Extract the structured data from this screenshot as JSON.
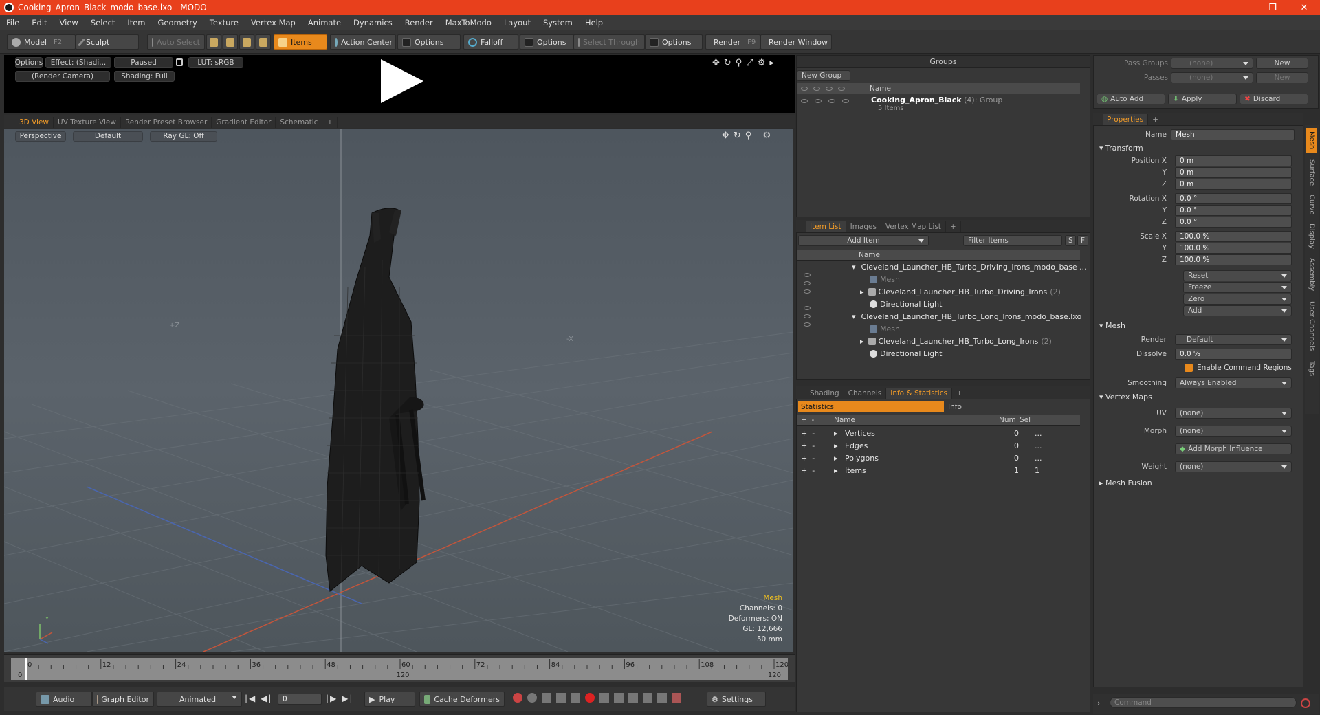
{
  "window": {
    "title": "Cooking_Apron_Black_modo_base.lxo - MODO",
    "min": "–",
    "max": "❐",
    "close": "✕"
  },
  "menu": [
    "File",
    "Edit",
    "View",
    "Select",
    "Item",
    "Geometry",
    "Texture",
    "Vertex Map",
    "Animate",
    "Dynamics",
    "Render",
    "MaxToModo",
    "Layout",
    "System",
    "Help"
  ],
  "toolbar": {
    "model": "Model",
    "model_key": "F2",
    "sculpt": "Sculpt",
    "auto_select": "Auto Select",
    "items": "Items",
    "action_center": "Action Center",
    "options1": "Options",
    "falloff": "Falloff",
    "options2": "Options",
    "select_through": "Select Through",
    "options3": "Options",
    "render": "Render",
    "render_key": "F9",
    "render_window": "Render Window"
  },
  "preview": {
    "options": "Options",
    "effect": "Effect: (Shadi...",
    "paused": "Paused",
    "lut": "LUT: sRGB",
    "camera": "(Render Camera)",
    "shading": "Shading: Full"
  },
  "viewport_tabs": [
    "3D View",
    "UV Texture View",
    "Render Preset Browser",
    "Gradient Editor",
    "Schematic",
    "+"
  ],
  "viewport": {
    "perspective": "Perspective",
    "default": "Default",
    "raygl": "Ray GL: Off",
    "info_title": "Mesh",
    "channels": "Channels: 0",
    "deformers": "Deformers: ON",
    "gl": "GL: 12,666",
    "lens": "50 mm",
    "axis_z": "+Z",
    "axis_x": "-X",
    "gizmo_y": "Y"
  },
  "timeline": {
    "ticks": [
      "0",
      "12",
      "24",
      "36",
      "48",
      "60",
      "72",
      "84",
      "96",
      "108",
      "120"
    ],
    "start": "0",
    "mid": "120",
    "end": "120"
  },
  "bottom": {
    "audio": "Audio",
    "graph_editor": "Graph Editor",
    "animated": "Animated",
    "frame": "0",
    "play": "Play",
    "cache": "Cache Deformers",
    "settings": "Settings"
  },
  "groups": {
    "title": "Groups",
    "new_group": "New Group",
    "col_name": "Name",
    "group_name": "Cooking_Apron_Black",
    "group_count": "(4)",
    "group_type": ": Group",
    "group_items": "5 Items"
  },
  "itemlist": {
    "tabs": [
      "Item List",
      "Images",
      "Vertex Map List",
      "+"
    ],
    "add_item": "Add Item",
    "filter": "Filter Items",
    "s": "S",
    "f": "F",
    "col_name": "Name",
    "rows": [
      {
        "name": "Cleveland_Launcher_HB_Turbo_Driving_Irons_modo_base ...",
        "suffix": ""
      },
      {
        "name": "Mesh",
        "suffix": ""
      },
      {
        "name": "Cleveland_Launcher_HB_Turbo_Driving_Irons",
        "suffix": "(2)"
      },
      {
        "name": "Directional Light",
        "suffix": ""
      },
      {
        "name": "Cleveland_Launcher_HB_Turbo_Long_Irons_modo_base.lxo",
        "suffix": ""
      },
      {
        "name": "Mesh",
        "suffix": ""
      },
      {
        "name": "Cleveland_Launcher_HB_Turbo_Long_Irons",
        "suffix": "(2)"
      },
      {
        "name": "Directional Light",
        "suffix": ""
      }
    ]
  },
  "stats": {
    "tabs": [
      "Shading",
      "Channels",
      "Info & Statistics",
      "+"
    ],
    "statistics": "Statistics",
    "info": "Info",
    "col_name": "Name",
    "col_num": "Num",
    "col_sel": "Sel",
    "rows": [
      {
        "name": "Vertices",
        "num": "0",
        "sel": "..."
      },
      {
        "name": "Edges",
        "num": "0",
        "sel": "..."
      },
      {
        "name": "Polygons",
        "num": "0",
        "sel": "..."
      },
      {
        "name": "Items",
        "num": "1",
        "sel": "1"
      }
    ]
  },
  "passes": {
    "pass_groups": "Pass Groups",
    "passes": "Passes",
    "none1": "(none)",
    "none2": "(none)",
    "new1": "New",
    "new2": "New",
    "auto_add": "Auto Add",
    "apply": "Apply",
    "discard": "Discard"
  },
  "props": {
    "tab": "Properties",
    "plus": "+",
    "name_label": "Name",
    "name_value": "Mesh",
    "transform": "Transform",
    "position_x": "Position X",
    "y": "Y",
    "z": "Z",
    "pos": [
      "0 m",
      "0 m",
      "0 m"
    ],
    "rotation_x": "Rotation X",
    "rot": [
      "0.0 °",
      "0.0 °",
      "0.0 °"
    ],
    "scale_x": "Scale X",
    "scale": [
      "100.0 %",
      "100.0 %",
      "100.0 %"
    ],
    "reset": "Reset",
    "freeze": "Freeze",
    "zero": "Zero",
    "add": "Add",
    "mesh": "Mesh",
    "render_label": "Render",
    "render_value": "Default",
    "dissolve_label": "Dissolve",
    "dissolve_value": "0.0 %",
    "enable_cmd": "Enable Command Regions",
    "smoothing_label": "Smoothing",
    "smoothing_value": "Always Enabled",
    "vertex_maps": "Vertex Maps",
    "uv_label": "UV",
    "uv_value": "(none)",
    "morph_label": "Morph",
    "morph_value": "(none)",
    "add_morph": "Add Morph Influence",
    "weight_label": "Weight",
    "weight_value": "(none)",
    "mesh_fusion": "Mesh Fusion",
    "command": "Command"
  },
  "side_tabs": [
    "Mesh",
    "Surface",
    "Curve",
    "Display",
    "Assembly",
    "User Channels",
    "Tags"
  ]
}
